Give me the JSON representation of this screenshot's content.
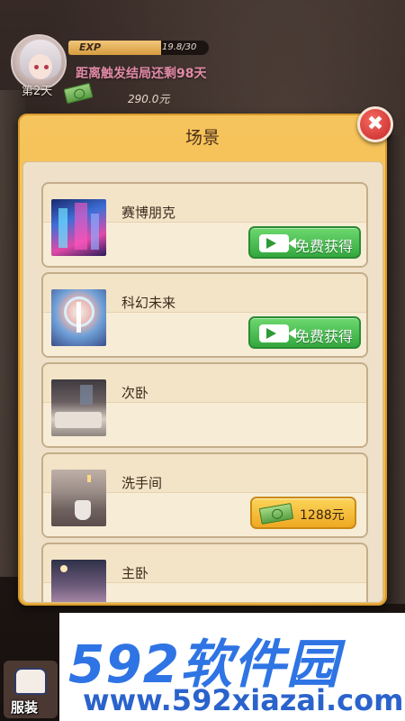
{
  "hud": {
    "day": "第2天",
    "exp_label": "EXP",
    "exp_value": "19.8/30",
    "exp_progress": 0.66,
    "countdown": "距离触发结局还剩98天",
    "money": "290.0元"
  },
  "modal": {
    "title": "场景",
    "close_label": "✖",
    "items": [
      {
        "name": "赛博朋克",
        "action": "免费获得",
        "thumb_icon": "cyberpunk-thumb"
      },
      {
        "name": "科幻未来",
        "action": "免费获得",
        "thumb_icon": "scifi-thumb"
      },
      {
        "name": "次卧",
        "action": "",
        "thumb_icon": "bedroom-thumb"
      },
      {
        "name": "洗手间",
        "price": "1288元",
        "thumb_icon": "bathroom-thumb"
      },
      {
        "name": "主卧",
        "action": "",
        "thumb_icon": "master-bedroom-thumb"
      }
    ]
  },
  "bottom": {
    "costume_label": "服装"
  },
  "watermark": {
    "brand": "592软件园",
    "url": "www.592xiazai.com"
  },
  "colors": {
    "modal_gold": "#f6c45c",
    "free_green": "#33a83e",
    "buy_gold": "#efa822",
    "close_red": "#c8262a"
  }
}
